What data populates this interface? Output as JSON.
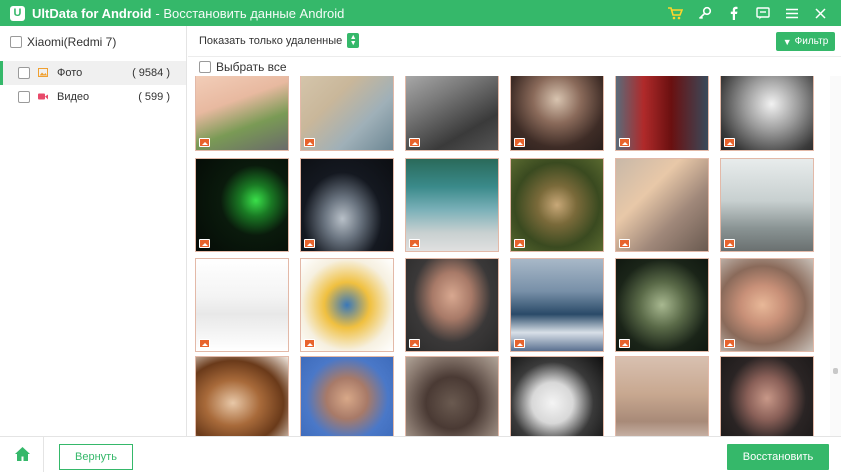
{
  "titlebar": {
    "logo_letter": "U",
    "app_name": "UltData for Android",
    "subtitle": "- Восстановить данные Android",
    "icons": [
      "cart-icon",
      "key-icon",
      "facebook-icon",
      "chat-icon",
      "menu-icon",
      "close-icon"
    ],
    "accent": "#35b86a"
  },
  "sidebar": {
    "device": "Xiaomi(Redmi 7)",
    "categories": [
      {
        "label": "Фото",
        "count": "( 9584 )",
        "icon": "photo-icon"
      },
      {
        "label": "Видео",
        "count": "( 599 )",
        "icon": "video-icon"
      }
    ]
  },
  "toolbar": {
    "filter_select": "Показать только удаленные",
    "filter_button": "Фильтр"
  },
  "select_all": "Выбрать все",
  "grid": {
    "thumbnail_count": 24,
    "badge_icon": "image-icon",
    "badge_color": "#e8632c"
  },
  "bottom": {
    "back": "Вернуть",
    "restore": "Восстановить"
  }
}
